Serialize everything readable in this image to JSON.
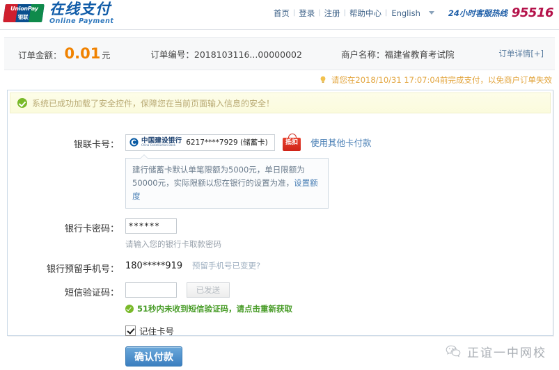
{
  "header": {
    "logo": {
      "mark_line1": "UnionPay",
      "mark_line2": "银联",
      "title_cn": "在线支付",
      "title_en": "Online Payment"
    },
    "nav": [
      {
        "label": "首页"
      },
      {
        "label": "登录"
      },
      {
        "label": "注册"
      },
      {
        "label": "帮助中心"
      }
    ],
    "separator": "|",
    "language": "English",
    "hotline_label": "24小时客服热线",
    "hotline_number": "95516"
  },
  "order": {
    "amount_label": "订单金额：",
    "amount": "0.01",
    "amount_unit": "元",
    "order_no_label": "订单编号：",
    "order_no": "2018103116...00000002",
    "merchant_label": "商户名称：",
    "merchant": "福建省教育考试院",
    "detail_link": "订单详情[+]",
    "deadline_notice": "请您在2018/10/31 17:07:04前完成支付，以免商户订单失效"
  },
  "secure_banner": {
    "text": "系统已成功加载了安全控件，保障您在当前页面输入信息的安全！"
  },
  "form": {
    "card_row": {
      "label": "银联卡号：",
      "bank_cn": "中国建设银行",
      "bank_en": "China Construction Bank",
      "card_number": "6217****7929 (储蓄卡)",
      "badge": "抵扣",
      "other_card_link": "使用其他卡付款"
    },
    "limit_notice": {
      "text": "建行储蓄卡默认单笔限额为5000元，单日限额为50000元，实际限额以您在银行的设置为准，",
      "link": "设置额度"
    },
    "password_row": {
      "label": "银行卡密码：",
      "value": "******",
      "hint": "请输入您的银行卡取款密码"
    },
    "phone_row": {
      "label": "银行预留手机号：",
      "value": "180*****919",
      "link": "预留手机号已变更?"
    },
    "sms_row": {
      "label": "短信验证码：",
      "value": "",
      "placeholder": "",
      "send_button": "已发送",
      "status": "51秒内未收到短信验证码，请点击重新获取"
    },
    "remember_card": {
      "label": "记住卡号",
      "checked": true
    },
    "submit_button": "确认付款"
  },
  "watermark": {
    "text": "正谊一中网校",
    "icon": "wechat-icon"
  },
  "colors": {
    "brand_blue": "#0f5ba8",
    "amount_orange": "#f08200",
    "hotline_red": "#b4124a",
    "badge_red": "#cf2418",
    "success_green": "#4a9d2a",
    "link_blue": "#4a7fb5",
    "notice_amber": "#e2a43c"
  }
}
